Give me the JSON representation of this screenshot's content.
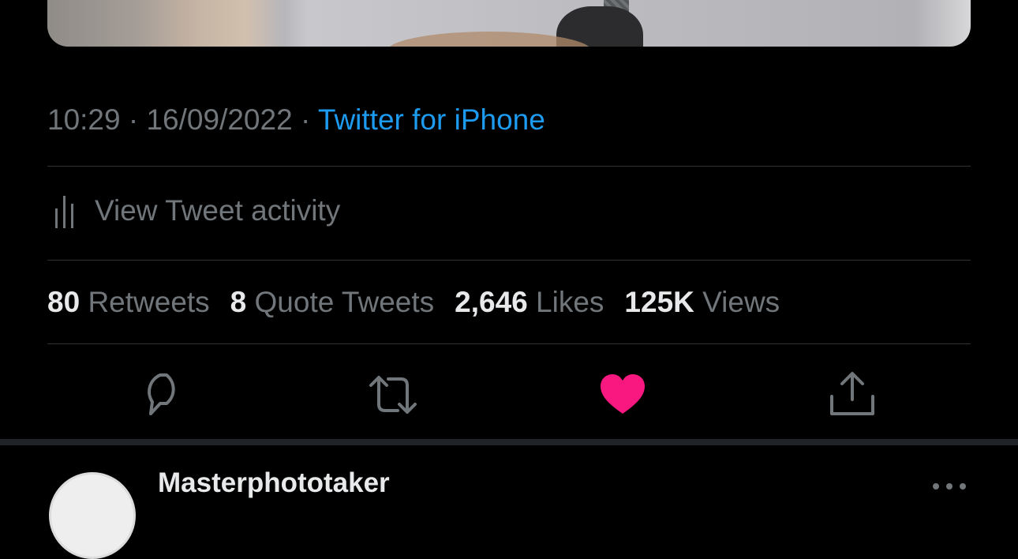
{
  "tweet": {
    "time": "10:29",
    "date": "16/09/2022",
    "separator": "·",
    "source": "Twitter for iPhone",
    "activity_label": "View Tweet activity",
    "stats": [
      {
        "value": "80",
        "label": "Retweets"
      },
      {
        "value": "8",
        "label": "Quote Tweets"
      },
      {
        "value": "2,646",
        "label": "Likes"
      },
      {
        "value": "125K",
        "label": "Views"
      }
    ],
    "liked": true
  },
  "actions": [
    {
      "name": "reply",
      "icon": "reply-icon"
    },
    {
      "name": "retweet",
      "icon": "retweet-icon"
    },
    {
      "name": "like",
      "icon": "heart-icon"
    },
    {
      "name": "share",
      "icon": "share-icon"
    }
  ],
  "reply": {
    "username": "Masterphototaker",
    "more_icon": "more-icon"
  },
  "colors": {
    "background": "#000000",
    "text_primary": "#e7e9ea",
    "text_secondary": "#71767b",
    "link": "#1d9bf0",
    "like": "#f91880",
    "divider": "#2f3336"
  }
}
